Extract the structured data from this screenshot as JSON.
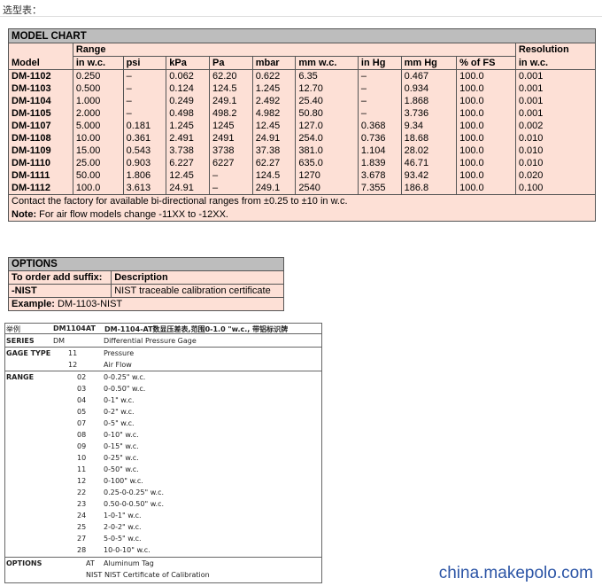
{
  "top_label": "选型表：",
  "model_chart": {
    "title": "MODEL CHART",
    "range_header": "Range",
    "resolution_header": "Resolution",
    "columns": [
      "Model",
      "in w.c.",
      "psi",
      "kPa",
      "Pa",
      "mbar",
      "mm w.c.",
      "in Hg",
      "mm Hg",
      "% of FS",
      "in w.c."
    ],
    "rows": [
      [
        "DM-1102",
        "0.250",
        "–",
        "0.062",
        "62.20",
        "0.622",
        "6.35",
        "–",
        "0.467",
        "100.0",
        "0.001"
      ],
      [
        "DM-1103",
        "0.500",
        "–",
        "0.124",
        "124.5",
        "1.245",
        "12.70",
        "–",
        "0.934",
        "100.0",
        "0.001"
      ],
      [
        "DM-1104",
        "1.000",
        "–",
        "0.249",
        "249.1",
        "2.492",
        "25.40",
        "–",
        "1.868",
        "100.0",
        "0.001"
      ],
      [
        "DM-1105",
        "2.000",
        "–",
        "0.498",
        "498.2",
        "4.982",
        "50.80",
        "–",
        "3.736",
        "100.0",
        "0.001"
      ],
      [
        "DM-1107",
        "5.000",
        "0.181",
        "1.245",
        "1245",
        "12.45",
        "127.0",
        "0.368",
        "9.34",
        "100.0",
        "0.002"
      ],
      [
        "DM-1108",
        "10.00",
        "0.361",
        "2.491",
        "2491",
        "24.91",
        "254.0",
        "0.736",
        "18.68",
        "100.0",
        "0.010"
      ],
      [
        "DM-1109",
        "15.00",
        "0.543",
        "3.738",
        "3738",
        "37.38",
        "381.0",
        "1.104",
        "28.02",
        "100.0",
        "0.010"
      ],
      [
        "DM-1110",
        "25.00",
        "0.903",
        "6.227",
        "6227",
        "62.27",
        "635.0",
        "1.839",
        "46.71",
        "100.0",
        "0.010"
      ],
      [
        "DM-1111",
        "50.00",
        "1.806",
        "12.45",
        "–",
        "124.5",
        "1270",
        "3.678",
        "93.42",
        "100.0",
        "0.020"
      ],
      [
        "DM-1112",
        "100.0",
        "3.613",
        "24.91",
        "–",
        "249.1",
        "2540",
        "7.355",
        "186.8",
        "100.0",
        "0.100"
      ]
    ],
    "contact_note": "Contact the factory for available bi-directional ranges from ±0.25 to ±10 in w.c.",
    "note_label": "Note:",
    "note_text": "For air flow models change -11XX to -12XX."
  },
  "options": {
    "title": "OPTIONS",
    "header_suffix": "To order add suffix:",
    "header_desc": "Description",
    "suffix": "-NIST",
    "desc": "NIST traceable calibration certificate",
    "example_label": "Example:",
    "example_value": "DM-1103-NIST"
  },
  "order_example": {
    "head_label": "举例",
    "head_model": "DM1104AT",
    "head_desc": "DM-1104-AT数显压差表,范围0-1.0 \"w.c., 带铝标识牌",
    "series_label": "SERIES",
    "series_code": "DM",
    "series_desc": "Differential Pressure Gage",
    "gage_label": "GAGE TYPE",
    "gage": [
      {
        "code": "11",
        "desc": "Pressure"
      },
      {
        "code": "12",
        "desc": "Air Flow"
      }
    ],
    "range_label": "RANGE",
    "ranges": [
      {
        "code": "02",
        "desc": "0-0.25\" w.c."
      },
      {
        "code": "03",
        "desc": "0-0.50\" w.c."
      },
      {
        "code": "04",
        "desc": "0-1\" w.c."
      },
      {
        "code": "05",
        "desc": "0-2\" w.c."
      },
      {
        "code": "07",
        "desc": "0-5\" w.c."
      },
      {
        "code": "08",
        "desc": "0-10\" w.c."
      },
      {
        "code": "09",
        "desc": "0-15\" w.c."
      },
      {
        "code": "10",
        "desc": "0-25\" w.c."
      },
      {
        "code": "11",
        "desc": "0-50\" w.c."
      },
      {
        "code": "12",
        "desc": "0-100\" w.c."
      },
      {
        "code": "22",
        "desc": "0.25-0-0.25\" w.c."
      },
      {
        "code": "23",
        "desc": "0.50-0-0.50\" w.c."
      },
      {
        "code": "24",
        "desc": "1-0-1\" w.c."
      },
      {
        "code": "25",
        "desc": "2-0-2\" w.c."
      },
      {
        "code": "27",
        "desc": "5-0-5\" w.c."
      },
      {
        "code": "28",
        "desc": "10-0-10\" w.c."
      }
    ],
    "options_label": "OPTIONS",
    "options": [
      {
        "code": "AT",
        "desc": "Aluminum Tag"
      },
      {
        "code": "NIST",
        "desc": "NIST Certificate of Calibration"
      }
    ]
  },
  "watermark": "china.makepolo.com"
}
